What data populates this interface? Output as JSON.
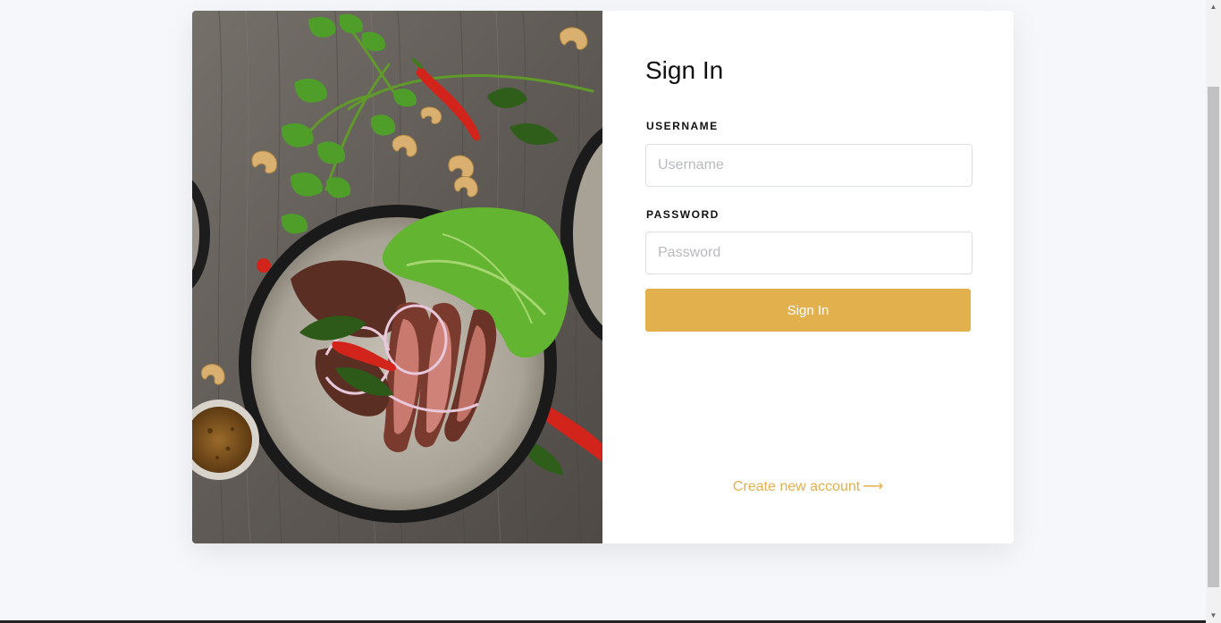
{
  "signin": {
    "title": "Sign In",
    "username_label": "USERNAME",
    "username_placeholder": "Username",
    "username_value": "",
    "password_label": "PASSWORD",
    "password_placeholder": "Password",
    "password_value": "",
    "submit_label": "Sign In",
    "create_account_label": "Create new account",
    "arrow_glyph": "⟶"
  },
  "colors": {
    "accent": "#e2b04d",
    "page_bg": "#f6f7fb",
    "card_bg": "#ffffff",
    "title_text": "#111111"
  },
  "icons": {
    "create_account_arrow": "arrow-right-icon"
  }
}
